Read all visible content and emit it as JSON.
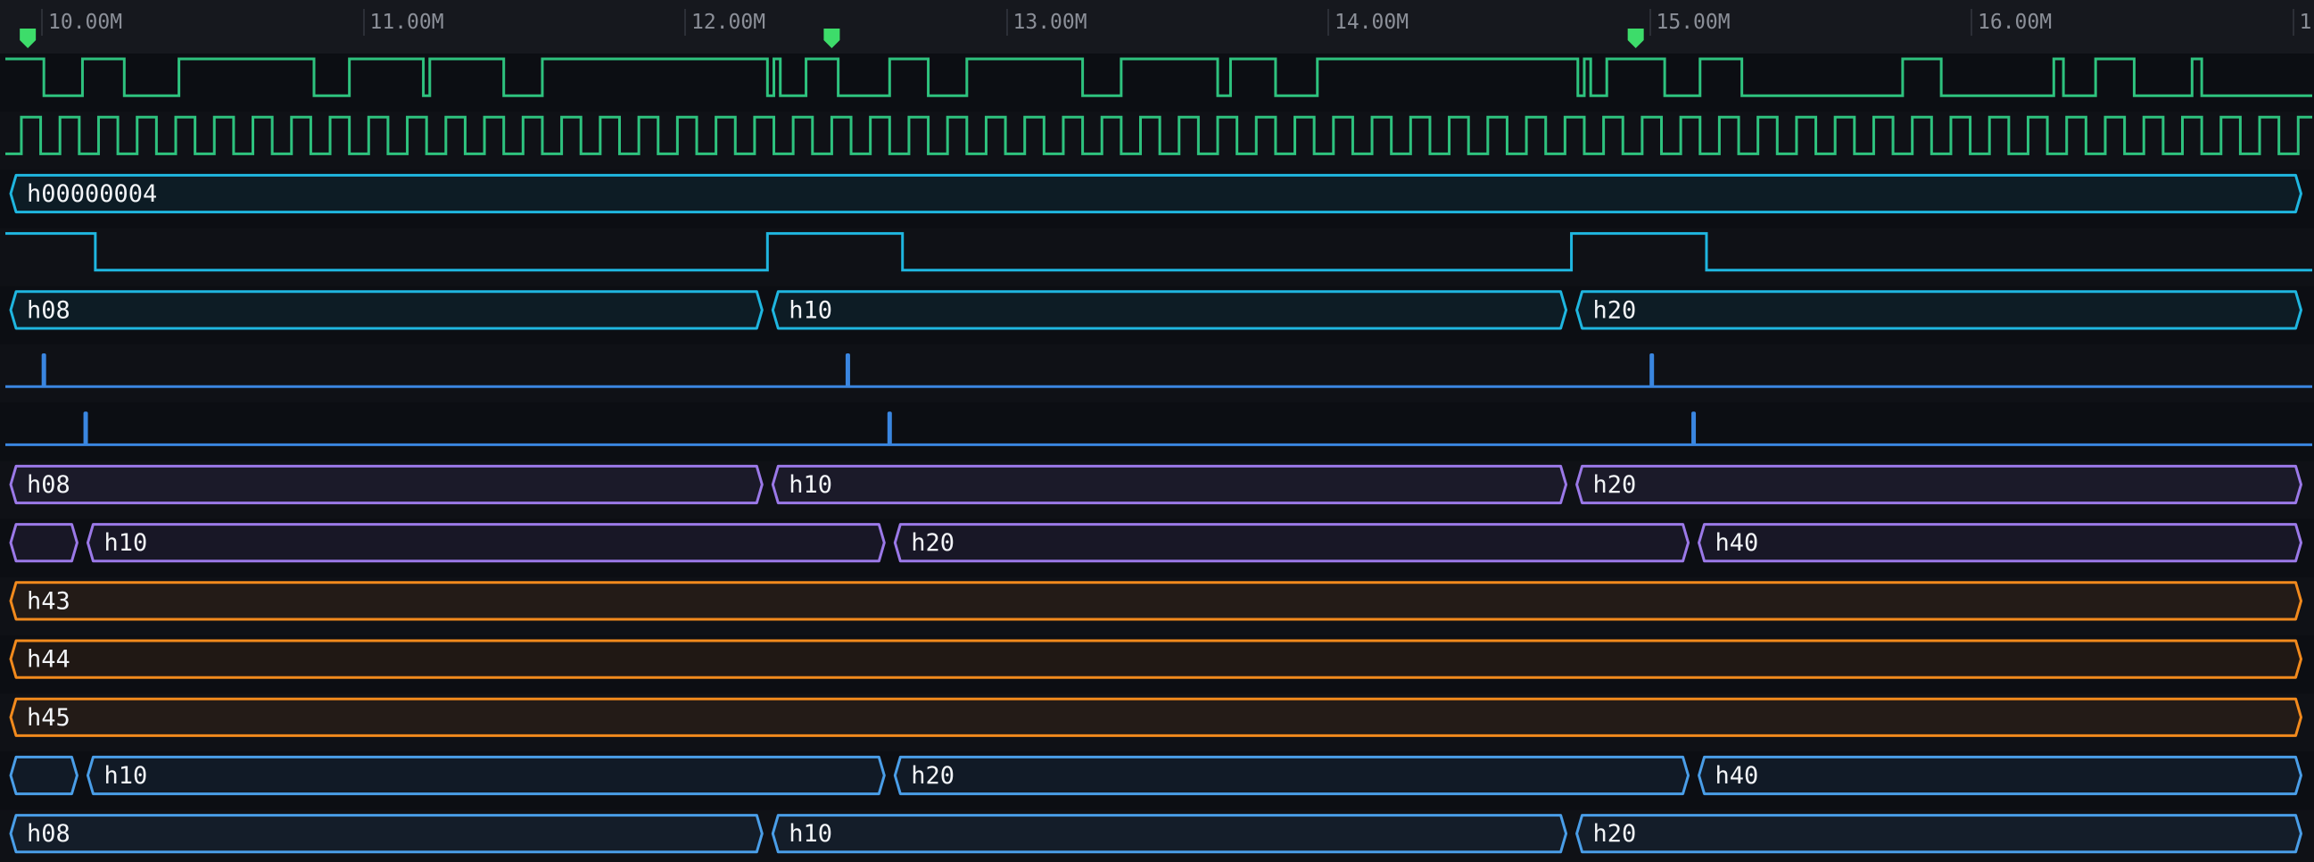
{
  "ruler": {
    "ticks": [
      "10.00M",
      "11.00M",
      "12.00M",
      "13.00M",
      "14.00M",
      "15.00M",
      "16.00M",
      "1"
    ]
  },
  "markers": [
    {
      "time": 9.92,
      "icon": "marker-flag-icon"
    },
    {
      "time": 12.42,
      "icon": "marker-flag-icon"
    },
    {
      "time": 14.92,
      "icon": "marker-flag-icon"
    }
  ],
  "colors": {
    "green": "#2ec27e",
    "cyan": "#1fb6e0",
    "blue": "#3a86e0",
    "purple": "#9b79e8",
    "orange": "#f28a1d",
    "lightblue": "#4a9ee8",
    "marker": "#3ddc6a"
  },
  "signals": [
    {
      "type": "bit",
      "color": "green",
      "initial": 1,
      "toggles": [
        9.97,
        10.09,
        10.22,
        10.39,
        10.81,
        10.92,
        11.15,
        11.17,
        11.4,
        11.52,
        12.22,
        12.24,
        12.26,
        12.34,
        12.44,
        12.6,
        12.72,
        12.84,
        13.2,
        13.32,
        13.62,
        13.66,
        13.8,
        13.93,
        14.74,
        14.76,
        14.78,
        14.83,
        15.01,
        15.12,
        15.25,
        15.75,
        15.87,
        16.22,
        16.25,
        16.35,
        16.47,
        16.65,
        16.68
      ]
    },
    {
      "type": "clock",
      "color": "green",
      "initial": 0,
      "start": 9.85,
      "first_toggle": 9.9,
      "period": 0.12
    },
    {
      "type": "bus",
      "color": "cyan",
      "segments": [
        {
          "start": 9.85,
          "end": 17.0,
          "label": "h00000004"
        }
      ]
    },
    {
      "type": "bit",
      "color": "cyan",
      "initial": 1,
      "toggles": [
        10.13,
        12.22,
        12.64,
        14.72,
        15.14
      ]
    },
    {
      "type": "bus",
      "color": "cyan",
      "segments": [
        {
          "start": 9.85,
          "end": 12.22,
          "label": "h08"
        },
        {
          "start": 12.22,
          "end": 14.72,
          "label": "h10"
        },
        {
          "start": 14.72,
          "end": 17.0,
          "label": "h20"
        }
      ]
    },
    {
      "type": "pulse",
      "color": "blue",
      "times": [
        9.97,
        12.47,
        14.97
      ]
    },
    {
      "type": "pulse",
      "color": "blue",
      "times": [
        10.1,
        12.6,
        15.1
      ]
    },
    {
      "type": "bus",
      "color": "purple",
      "segments": [
        {
          "start": 9.85,
          "end": 12.22,
          "label": "h08"
        },
        {
          "start": 12.22,
          "end": 14.72,
          "label": "h10"
        },
        {
          "start": 14.72,
          "end": 17.0,
          "label": "h20"
        }
      ]
    },
    {
      "type": "bus",
      "color": "purple",
      "segments": [
        {
          "start": 9.85,
          "end": 10.09,
          "label": ""
        },
        {
          "start": 10.09,
          "end": 12.6,
          "label": "h10"
        },
        {
          "start": 12.6,
          "end": 15.1,
          "label": "h20"
        },
        {
          "start": 15.1,
          "end": 17.0,
          "label": "h40"
        }
      ]
    },
    {
      "type": "bus",
      "color": "orange",
      "segments": [
        {
          "start": 9.85,
          "end": 17.0,
          "label": "h43"
        }
      ]
    },
    {
      "type": "bus",
      "color": "orange",
      "segments": [
        {
          "start": 9.85,
          "end": 17.0,
          "label": "h44"
        }
      ]
    },
    {
      "type": "bus",
      "color": "orange",
      "segments": [
        {
          "start": 9.85,
          "end": 17.0,
          "label": "h45"
        }
      ]
    },
    {
      "type": "bus",
      "color": "lightblue",
      "segments": [
        {
          "start": 9.85,
          "end": 10.09,
          "label": ""
        },
        {
          "start": 10.09,
          "end": 12.6,
          "label": "h10"
        },
        {
          "start": 12.6,
          "end": 15.1,
          "label": "h20"
        },
        {
          "start": 15.1,
          "end": 17.0,
          "label": "h40"
        }
      ]
    },
    {
      "type": "bus",
      "color": "lightblue",
      "segments": [
        {
          "start": 9.85,
          "end": 12.22,
          "label": "h08"
        },
        {
          "start": 12.22,
          "end": 14.72,
          "label": "h10"
        },
        {
          "start": 14.72,
          "end": 17.0,
          "label": "h20"
        }
      ]
    }
  ]
}
